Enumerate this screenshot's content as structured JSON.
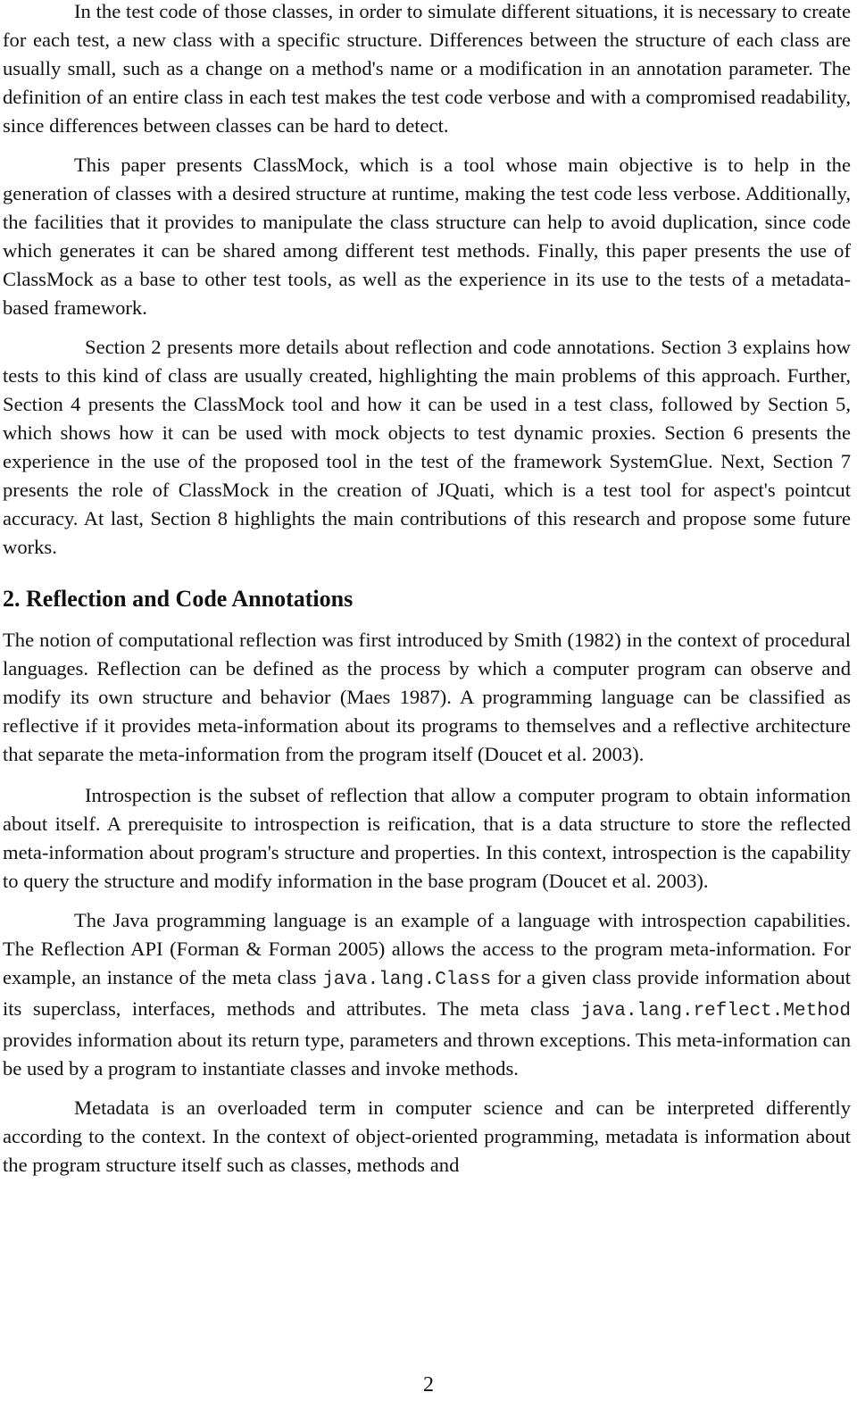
{
  "paragraphs": [
    "In the test code of those classes, in order to simulate different situations, it is necessary to create for each test, a new class with a specific structure. Differences between the structure of each class are usually small, such as a change on a method's name or a modification in an annotation parameter. The definition of an entire class in each test makes the test code verbose and with a compromised readability, since differences between  classes can be hard to detect.",
    "This paper presents ClassMock, which is a tool whose main objective is to help in the generation of classes with a desired structure at runtime, making the test code less verbose. Additionally, the facilities that it provides to manipulate the class structure can help to avoid duplication, since code which generates it can be shared among different test methods. Finally, this paper presents the use of ClassMock as a base to other test tools, as well as the experience in its use to the tests of a metadata-based framework.",
    "Section 2 presents more details about reflection and code annotations. Section 3 explains how tests to this kind of class are usually created, highlighting the main problems of this approach. Further, Section 4 presents the ClassMock tool and how it can be used in a test class, followed by Section 5, which shows how it can be used with mock objects to test dynamic proxies. Section 6 presents the experience in the use of the proposed tool in the test of the framework SystemGlue. Next, Section 7 presents the role of ClassMock in the creation of JQuati, which is a test tool for aspect's pointcut accuracy. At last, Section 8 highlights the main contributions of this research and propose some future works."
  ],
  "section": {
    "heading": "2. Reflection and Code Annotations",
    "paragraphs": [
      "The notion of computational reflection was first introduced by Smith (1982) in the context of procedural languages. Reflection can be defined as the process by which a computer program can observe and modify its own structure and behavior (Maes 1987). A programming language can be classified as reflective if it provides meta-information about its programs to themselves and a reflective architecture that separate the meta-information from the program itself (Doucet et al. 2003).",
      "Introspection is the subset of reflection that allow a computer program to obtain information about itself. A prerequisite to introspection is reification, that is a data structure to store the reflected meta-information about program's structure and properties. In this context, introspection is the capability to query the structure and modify information in the base program (Doucet et al. 2003)."
    ],
    "java_para": {
      "part1": "The Java programming language is an example of a language with introspection capabilities. The Reflection API (Forman & Forman 2005) allows the access to the program meta-information. For example, an instance of the meta class ",
      "code1": "java.lang.Class",
      "part2": " for a given class provide information about its superclass, interfaces, methods and attributes. The meta class ",
      "code2": "java.lang.reflect.Method",
      "part3": " provides information about its return type, parameters and thrown exceptions. This meta-information can be used by a program to instantiate classes and invoke methods."
    },
    "last_paragraph": "Metadata is an overloaded term in computer science and can be interpreted differently according to the context. In the context of object-oriented programming, metadata is information about the program structure itself such as classes, methods and"
  },
  "page_number": "2"
}
